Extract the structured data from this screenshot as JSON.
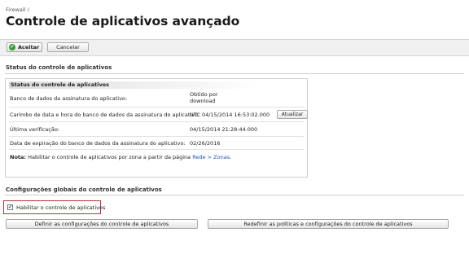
{
  "breadcrumb": "Firewall /",
  "page_title": "Controle de aplicativos avançado",
  "toolbar": {
    "accept_label": "Aceitar",
    "cancel_label": "Cancelar"
  },
  "status_section": {
    "title": "Status do controle de aplicativos",
    "panel_title": "Status do controle de aplicativos",
    "rows": [
      {
        "label": "Banco de dados da assinatura do aplicativo:",
        "value_line1": "Obtido por",
        "value_line2": "download"
      },
      {
        "label": "Carimbo de data e hora do banco de dados da assinatura do aplicativo:",
        "value": "UTC 04/15/2014 16:53:02.000",
        "button": "Atualizar"
      },
      {
        "label": "Última verificação:",
        "value": "04/15/2014 21:28:44.000"
      },
      {
        "label": "Data de expiração do banco de dados da assinatura do aplicativo:",
        "value": "02/26/2016"
      }
    ],
    "note": {
      "prefix": "Nota:",
      "text": "Habilitar o controle de aplicativos por zona a partir da página",
      "link": "Rede > Zonas",
      "suffix": "."
    }
  },
  "global_section": {
    "title": "Configurações globais do controle de aplicativos",
    "enable_label": "Habilitar o controle de aplicativos",
    "enable_checked": true,
    "define_button": "Definir as configurações do controle de aplicativos",
    "reset_button": "Redefinir as políticas e configurações do controle de aplicativos"
  },
  "colors": {
    "accept_icon": "#3a9a34",
    "highlight_border": "#b8343a",
    "link": "#2255aa"
  }
}
